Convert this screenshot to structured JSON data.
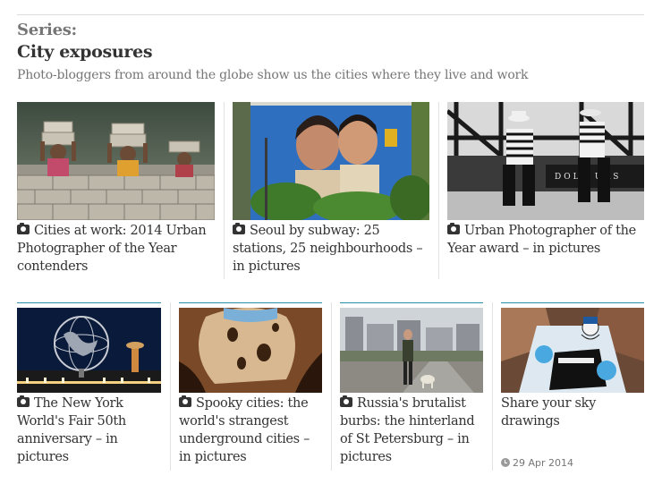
{
  "series": {
    "label": "Series:",
    "title": "City exposures",
    "description": "Photo-bloggers from around the globe show us the cities where they live and work"
  },
  "row1": [
    {
      "title": "Cities at work: 2014 Urban Photographer of the Year contenders",
      "icon": "camera-icon",
      "image": "workers carrying bricks on their heads"
    },
    {
      "title": "Seoul by subway: 25 stations, 25 neighbourhoods – in pictures",
      "icon": "camera-icon",
      "image": "blue mural of a couple"
    },
    {
      "title": "Urban Photographer of the Year award – in pictures",
      "icon": "camera-icon",
      "image": "black and white gondoliers"
    }
  ],
  "row2": [
    {
      "title": "The New York World's Fair 50th anniversary – in pictures",
      "icon": "camera-icon",
      "image": "Unisphere at night"
    },
    {
      "title": "Spooky cities: the world's strangest underground cities – in pictures",
      "icon": "camera-icon",
      "image": "cave dwellings"
    },
    {
      "title": "Russia's brutalist burbs: the hinterland of St Petersburg – in pictures",
      "icon": "camera-icon",
      "image": "man with dog before apartment blocks"
    },
    {
      "title": "Share your sky drawings",
      "icon": "",
      "image": "sky drawing cartoon",
      "timestamp": "29 Apr 2014"
    }
  ],
  "colors": {
    "accent": "#2b8fa8",
    "text": "#333333",
    "muted": "#767676"
  }
}
